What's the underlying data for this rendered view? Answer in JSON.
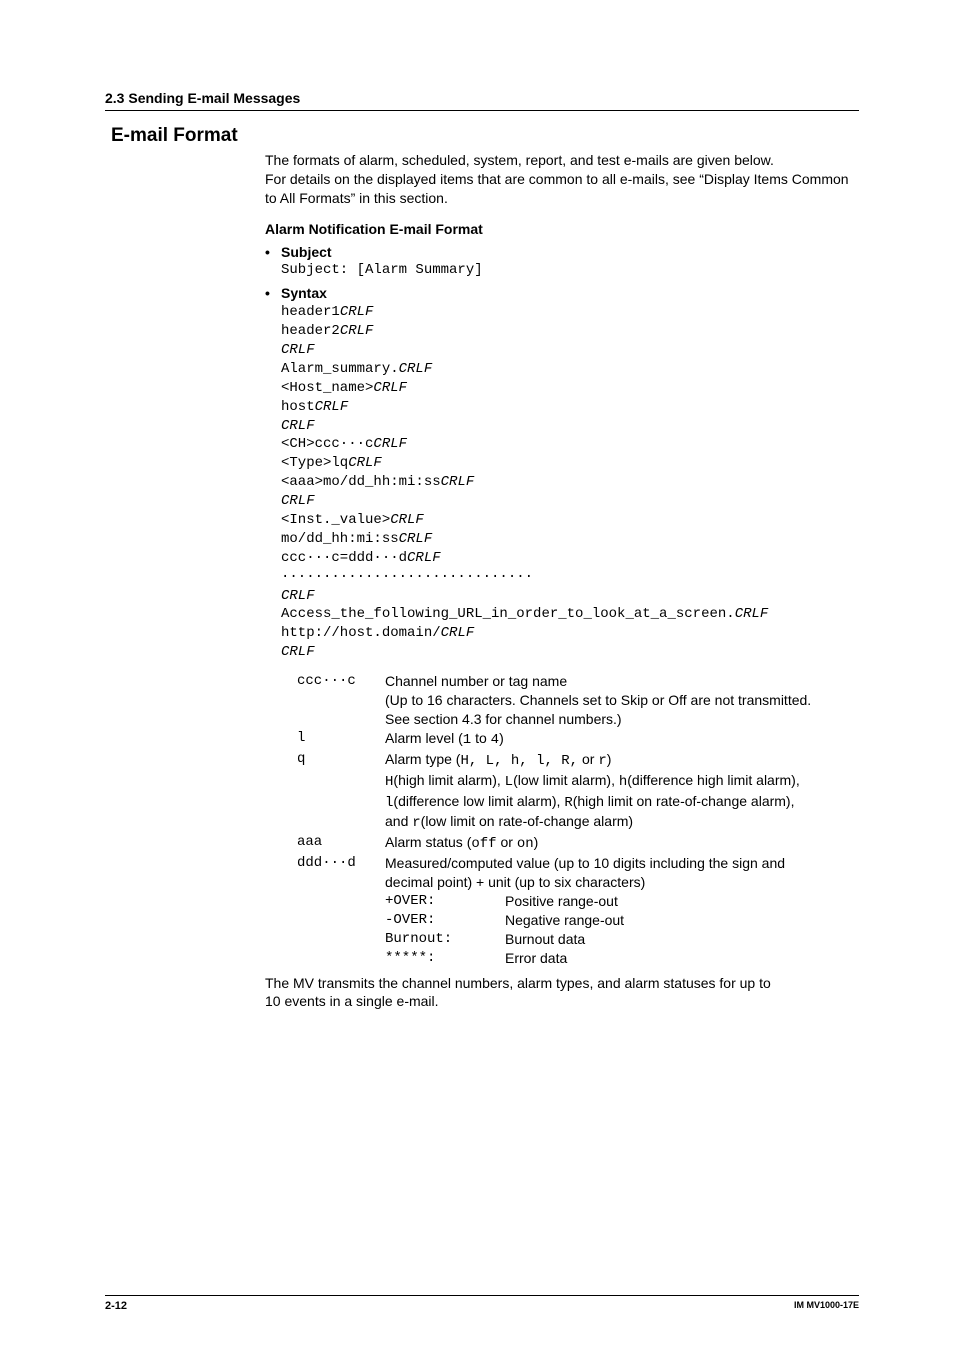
{
  "header": {
    "section": "2.3  Sending E-mail Messages"
  },
  "title": "E-mail Format",
  "intro": {
    "p1": "The formats of alarm, scheduled, system, report, and test e-mails are given below.",
    "p2": "For details on the displayed items that are common to all e-mails, see “Display Items Common to All Formats” in this section."
  },
  "alarm": {
    "heading": "Alarm Notification E-mail Format",
    "subject_label": "Subject",
    "subject_line": "Subject: [Alarm Summary]",
    "syntax_label": "Syntax",
    "syntax_lines": [
      {
        "t": "header1",
        "i": "CRLF"
      },
      {
        "t": "header2",
        "i": "CRLF"
      },
      {
        "t": "",
        "i": "CRLF"
      },
      {
        "t": "Alarm_summary.",
        "i": "CRLF"
      },
      {
        "t": "<Host_name>",
        "i": "CRLF"
      },
      {
        "t": "host",
        "i": "CRLF"
      },
      {
        "t": "",
        "i": "CRLF"
      },
      {
        "t": "<CH>ccc···c",
        "i": "CRLF"
      },
      {
        "t": "<Type>lq",
        "i": "CRLF"
      },
      {
        "t": "<aaa>mo/dd_hh:mi:ss",
        "i": "CRLF"
      },
      {
        "t": "",
        "i": "CRLF"
      },
      {
        "t": "<Inst._value>",
        "i": "CRLF"
      },
      {
        "t": "mo/dd_hh:mi:ss",
        "i": "CRLF"
      },
      {
        "t": "ccc···c=ddd···d",
        "i": "CRLF"
      },
      {
        "t": "······························",
        "i": ""
      },
      {
        "t": "",
        "i": "CRLF"
      },
      {
        "t": "Access_the_following_URL_in_order_to_look_at_a_screen.",
        "i": "CRLF"
      },
      {
        "t": "http://host.domain/",
        "i": "CRLF"
      },
      {
        "t": "",
        "i": "CRLF"
      }
    ],
    "defs": {
      "ccc": {
        "term": "ccc···c",
        "l1": "Channel number or tag name",
        "l2": "(Up to 16 characters. Channels set to Skip or Off are not transmitted.",
        "l3": "See section 4.3 for channel numbers.)"
      },
      "l": {
        "term": "l",
        "pre": "Alarm level (",
        "mono": "1",
        "mid": " to ",
        "mono2": "4",
        "post": ")"
      },
      "q": {
        "term": "q",
        "pre": "Alarm type (",
        "mono": "H, L, h, l, R,",
        "mid": " or ",
        "mono2": "r",
        "post": ")",
        "d1a": "H",
        "d1b": "(high limit alarm), ",
        "d1c": "L",
        "d1d": "(low limit alarm), ",
        "d1e": "h",
        "d1f": "(difference high limit alarm),",
        "d2a": "l",
        "d2b": "(difference low limit alarm), ",
        "d2c": "R",
        "d2d": "(high limit on rate-of-change alarm),",
        "d3a": "and ",
        "d3b": "r",
        "d3c": "(low limit on rate-of-change alarm)"
      },
      "aaa": {
        "term": "aaa",
        "pre": "Alarm status (",
        "mono": "off",
        "mid": " or ",
        "mono2": "on",
        "post": ")"
      },
      "ddd": {
        "term": "ddd···d",
        "l1": "Measured/computed value (up to 10 digits including the sign and",
        "l2": "decimal point) + unit (up to six characters)",
        "sub": [
          {
            "t": "+OVER:",
            "d": "Positive range-out"
          },
          {
            "t": "-OVER:",
            "d": "Negative range-out"
          },
          {
            "t": "Burnout:",
            "d": "Burnout data"
          },
          {
            "t": "*****:",
            "d": "Error data"
          }
        ]
      }
    },
    "closing": {
      "l1": "The MV transmits the channel numbers, alarm types, and alarm statuses for up to",
      "l2": "10 events in a single e-mail."
    }
  },
  "footer": {
    "page": "2-12",
    "doc": "IM MV1000-17E"
  }
}
